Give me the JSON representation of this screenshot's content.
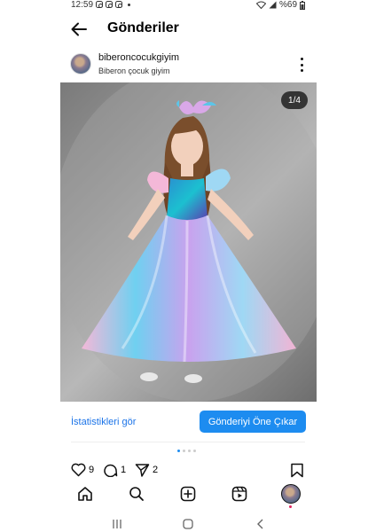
{
  "status": {
    "time": "12:59",
    "battery": "%69"
  },
  "header": {
    "title": "Gönderiler"
  },
  "post": {
    "username": "biberoncocukgiyim",
    "subtitle": "Biberon çocuk giyim",
    "image_counter": "1/4",
    "stats_label": "İstatistikleri gör",
    "promote_label": "Gönderiyi Öne Çıkar",
    "likes": "9",
    "comments": "1",
    "shares": "2"
  },
  "colors": {
    "accent": "#1d8cf0",
    "link": "#1a73e8"
  }
}
